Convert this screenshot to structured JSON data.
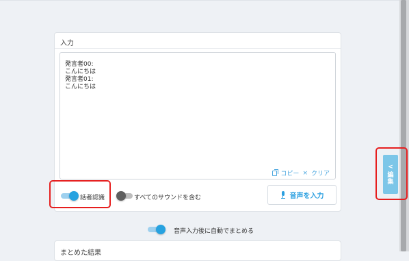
{
  "input_card": {
    "title": "入力",
    "text_lines": [
      "発言者00:",
      "こんにちは",
      "発言者01:",
      "こんにちは"
    ],
    "copy_label": "コピー",
    "clear_separator": "×",
    "clear_label": "クリア"
  },
  "controls": {
    "speaker_recognition": {
      "label": "話者認識",
      "on": true
    },
    "include_all_sounds": {
      "label": "すべてのサウンドを含む",
      "on": false
    },
    "voice_input_button_label": "音声を入力"
  },
  "auto_summary": {
    "label": "音声入力後に自動でまとめる",
    "on": true
  },
  "edit_tab": {
    "chevron": "<",
    "chars": [
      "編",
      "集"
    ]
  },
  "second_card": {
    "title": "まとめた結果"
  },
  "colors": {
    "accent": "#27a2e0",
    "highlight": "#e61e1e",
    "edit_tab": "#7cc6e8"
  }
}
